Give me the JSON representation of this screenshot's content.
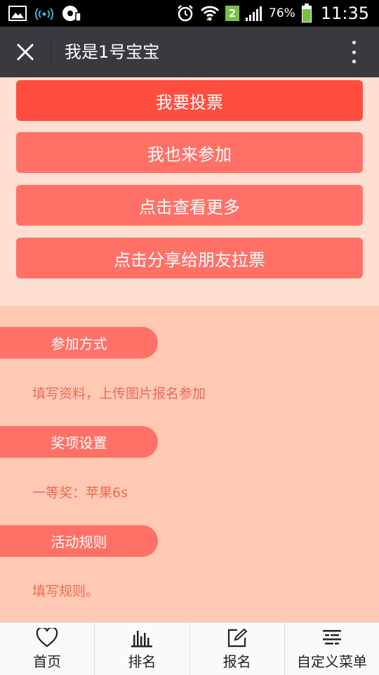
{
  "status_bar": {
    "sim_badge": "2",
    "battery_percent": "76%",
    "time": "11:35"
  },
  "title_bar": {
    "title": "我是1号宝宝"
  },
  "buttons": {
    "vote": "我要投票",
    "join": "我也来参加",
    "view_more": "点击查看更多",
    "share": "点击分享给朋友拉票"
  },
  "sections": [
    {
      "title": "参加方式",
      "text": "填写资料，上传图片报名参加"
    },
    {
      "title": "奖项设置",
      "text": "一等奖：苹果6s"
    },
    {
      "title": "活动规则",
      "text": "填写规则。"
    }
  ],
  "bottom_nav": [
    {
      "label": "首页",
      "icon": "heart-icon"
    },
    {
      "label": "排名",
      "icon": "bar-chart-icon"
    },
    {
      "label": "报名",
      "icon": "edit-icon"
    },
    {
      "label": "自定义菜单",
      "icon": "menu-icon"
    }
  ],
  "colors": {
    "primary_red": "#ff4e3f",
    "light_red": "#ff7167",
    "title_bar": "#393a3f",
    "page_bg": "#ffc9b3",
    "text_accent": "#ee6a55"
  }
}
